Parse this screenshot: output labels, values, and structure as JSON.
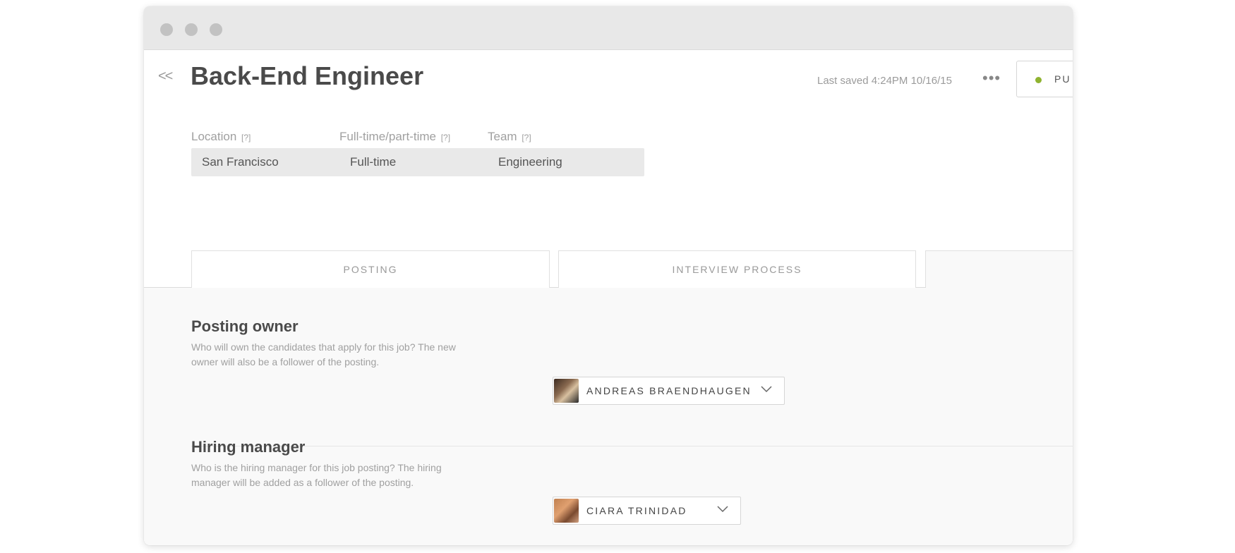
{
  "header": {
    "title": "Back-End Engineer",
    "last_saved": "Last saved 4:24PM 10/16/15",
    "back_label": "<<",
    "more_label": "•••",
    "publish_label": "PU",
    "publish_status_color": "#8fb330"
  },
  "fields": [
    {
      "label": "Location",
      "help": "[?]",
      "value": "San Francisco"
    },
    {
      "label": "Full-time/part-time",
      "help": "[?]",
      "value": "Full-time"
    },
    {
      "label": "Team",
      "help": "[?]",
      "value": "Engineering"
    }
  ],
  "tabs": [
    {
      "label": "POSTING"
    },
    {
      "label": "INTERVIEW PROCESS"
    }
  ],
  "sections": {
    "posting_owner": {
      "title": "Posting owner",
      "description": "Who will own the candidates that apply for this job? The new owner will also be a follower of the posting.",
      "selected_person": "ANDREAS BRAENDHAUGEN"
    },
    "hiring_manager": {
      "title": "Hiring manager",
      "description": "Who is the hiring manager for this job posting? The hiring manager will be added as a follower of the posting.",
      "selected_person": "CIARA TRINIDAD"
    }
  }
}
